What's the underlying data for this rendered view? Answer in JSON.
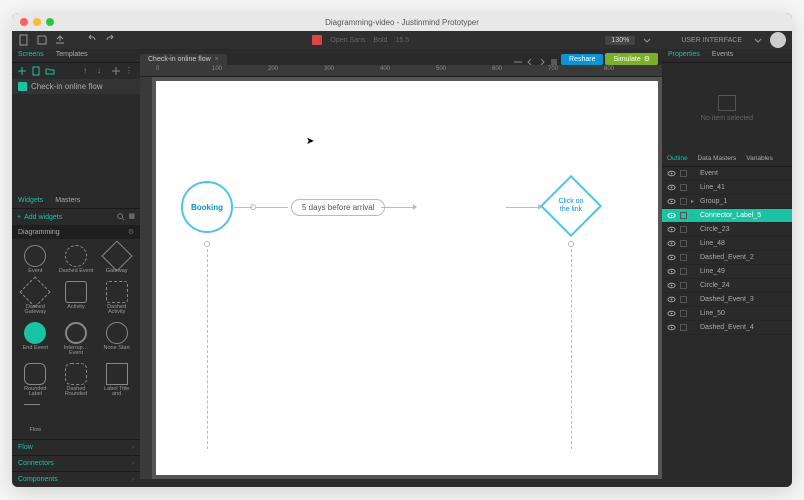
{
  "window": {
    "title": "Diagramming-video - Justinmind Prototyper"
  },
  "toolbar": {
    "font_label": "Open Sans",
    "weight_label": "Bold",
    "size_label": "15.5",
    "zoom": "130%",
    "ui_dropdown": "USER INTERFACE"
  },
  "left_panel": {
    "tabs": {
      "screens": "Screens",
      "templates": "Templates"
    },
    "screen_item": "Check-in online flow",
    "tabs2": {
      "widgets": "Widgets",
      "masters": "Masters"
    },
    "add_widgets": "Add widgets",
    "section_diagramming": "Diagramming",
    "widgets": [
      {
        "key": "event",
        "label": "Event",
        "shape": "circle"
      },
      {
        "key": "dashed-event",
        "label": "Dashed\nEvent",
        "shape": "dcircle"
      },
      {
        "key": "gateway",
        "label": "Gateway",
        "shape": "diamond"
      },
      {
        "key": "dashed-gateway",
        "label": "Dashed\nGateway",
        "shape": "ddiamond"
      },
      {
        "key": "activity",
        "label": "Activity",
        "shape": "rrect"
      },
      {
        "key": "dashed-activity",
        "label": "Dashed\nActivity",
        "shape": "drrect"
      },
      {
        "key": "end-event",
        "label": "End Event",
        "shape": "fillcircle"
      },
      {
        "key": "interrupt-event",
        "label": "Interrup…\nEvent",
        "shape": "ring"
      },
      {
        "key": "none-start",
        "label": "None\nStart",
        "shape": "nonestart"
      },
      {
        "key": "rounded-label",
        "label": "Rounded\nLabel",
        "shape": "rlabel"
      },
      {
        "key": "dashed-rounded",
        "label": "Dashed\nRounded",
        "shape": "drlabel"
      },
      {
        "key": "label-title",
        "label": "Label Title\nand",
        "shape": "ltitle"
      },
      {
        "key": "flow",
        "label": "Flow",
        "shape": "arrow"
      }
    ],
    "categories": {
      "flow": "Flow",
      "connectors": "Connectors",
      "components": "Components"
    }
  },
  "center": {
    "tab_name": "Check-in online flow",
    "btn_reshare": "Reshare",
    "btn_simulate": "Simulate",
    "ruler_ticks": [
      "0",
      "100",
      "200",
      "300",
      "400",
      "500",
      "600",
      "700",
      "800"
    ],
    "booking_label": "Booking",
    "connector_label": "5 days before arrival",
    "decision_label": "Click on\nthe link"
  },
  "right_panel": {
    "tabs": {
      "properties": "Properties",
      "events": "Events"
    },
    "empty_text": "No item selected",
    "tabs3": {
      "outline": "Outline",
      "datamasters": "Data Masters",
      "variables": "Variables"
    },
    "outline": [
      {
        "name": "Event",
        "selected": false,
        "expandable": false
      },
      {
        "name": "Line_41",
        "selected": false,
        "expandable": false
      },
      {
        "name": "Group_1",
        "selected": false,
        "expandable": true
      },
      {
        "name": "Connector_Label_5",
        "selected": true,
        "expandable": true
      },
      {
        "name": "Circle_23",
        "selected": false,
        "expandable": false
      },
      {
        "name": "Line_48",
        "selected": false,
        "expandable": false
      },
      {
        "name": "Dashed_Event_2",
        "selected": false,
        "expandable": false
      },
      {
        "name": "Line_49",
        "selected": false,
        "expandable": false
      },
      {
        "name": "Circle_24",
        "selected": false,
        "expandable": false
      },
      {
        "name": "Dashed_Event_3",
        "selected": false,
        "expandable": false
      },
      {
        "name": "Line_50",
        "selected": false,
        "expandable": false
      },
      {
        "name": "Dashed_Event_4",
        "selected": false,
        "expandable": false
      }
    ]
  }
}
